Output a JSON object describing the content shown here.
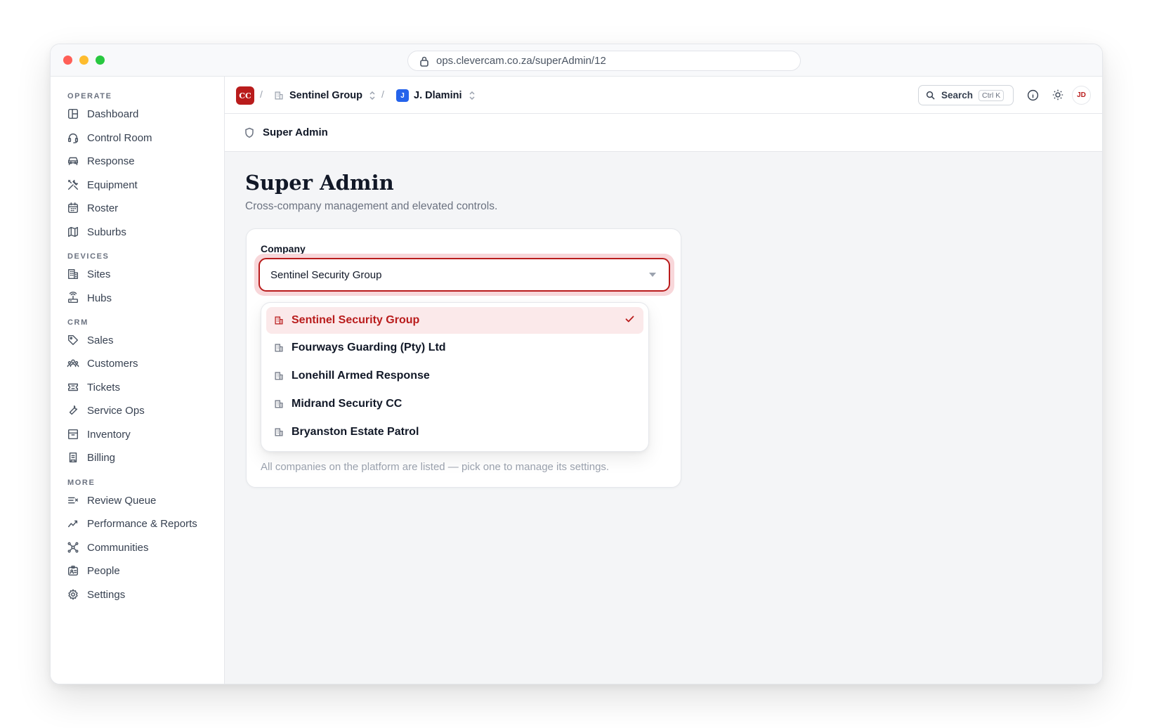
{
  "browser": {
    "url": "ops.clevercam.co.za/superAdmin/12"
  },
  "sidebar": {
    "sections": [
      {
        "label": "OPERATE"
      },
      {
        "label": "DEVICES"
      },
      {
        "label": "CRM"
      },
      {
        "label": "MORE"
      }
    ],
    "items": [
      {
        "label": "Dashboard",
        "icon": "dashboard-icon"
      },
      {
        "label": "Control Room",
        "icon": "headset-icon"
      },
      {
        "label": "Response",
        "icon": "car-icon"
      },
      {
        "label": "Equipment",
        "icon": "tools-icon"
      },
      {
        "label": "Roster",
        "icon": "calendar-icon"
      },
      {
        "label": "Suburbs",
        "icon": "map-icon"
      },
      {
        "label": "Sites",
        "icon": "building-icon"
      },
      {
        "label": "Hubs",
        "icon": "router-icon"
      },
      {
        "label": "Sales",
        "icon": "tag-icon"
      },
      {
        "label": "Customers",
        "icon": "users-icon"
      },
      {
        "label": "Tickets",
        "icon": "ticket-icon"
      },
      {
        "label": "Service Ops",
        "icon": "wrench-icon"
      },
      {
        "label": "Inventory",
        "icon": "archive-icon"
      },
      {
        "label": "Billing",
        "icon": "receipt-icon"
      },
      {
        "label": "Review Queue",
        "icon": "list-check-icon"
      },
      {
        "label": "Performance & Reports",
        "icon": "trend-icon"
      },
      {
        "label": "Communities",
        "icon": "network-icon"
      },
      {
        "label": "People",
        "icon": "id-badge-icon"
      },
      {
        "label": "Settings",
        "icon": "gear-icon"
      }
    ]
  },
  "topbar": {
    "logo_text": "CC",
    "separator": "/",
    "company_crumb": "Sentinel Group",
    "user_initial": "J",
    "user_crumb": "J. Dlamini",
    "search_label": "Search",
    "search_shortcut": "Ctrl K",
    "avatar_initials": "JD"
  },
  "subbar": {
    "title": "Super Admin"
  },
  "page": {
    "title": "Super Admin",
    "subtitle": "Cross-company management and elevated controls."
  },
  "company_card": {
    "label": "Company",
    "selected_value": "Sentinel Security Group",
    "hint": "All companies on the platform are listed — pick one to manage its settings.",
    "options": [
      {
        "label": "Sentinel Security Group",
        "selected": true
      },
      {
        "label": "Fourways Guarding (Pty) Ltd",
        "selected": false
      },
      {
        "label": "Lonehill Armed Response",
        "selected": false
      },
      {
        "label": "Midrand Security CC",
        "selected": false
      },
      {
        "label": "Bryanston Estate Patrol",
        "selected": false
      }
    ]
  },
  "colors": {
    "accent": "#b91c1c",
    "selected_bg": "#fbe9ea",
    "ring": "#f8d7da",
    "user_badge": "#2563eb"
  }
}
